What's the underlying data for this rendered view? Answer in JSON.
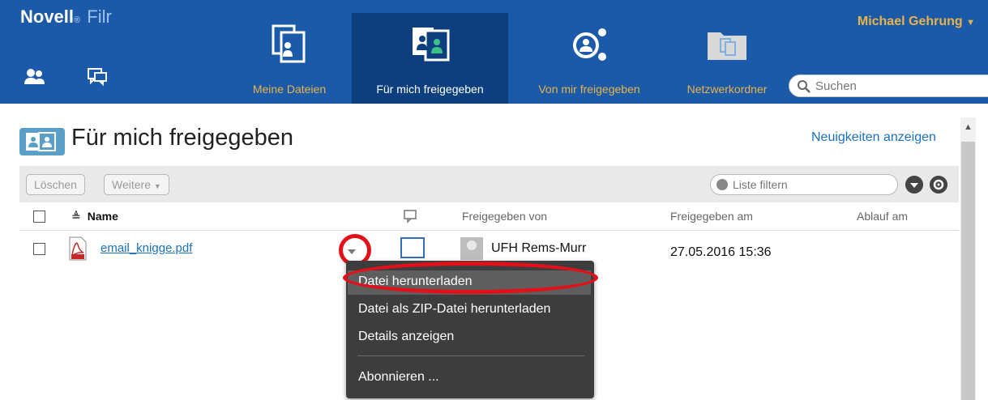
{
  "header": {
    "logo_brand": "Novell",
    "logo_product": "Filr",
    "user_name": "Michael Gehrung",
    "search_placeholder": "Suchen",
    "nav_tabs": [
      {
        "label": "Meine Dateien"
      },
      {
        "label": "Für mich freigegeben"
      },
      {
        "label": "Von mir freigegeben"
      },
      {
        "label": "Netzwerkordner"
      }
    ],
    "active_tab": "Für mich freigegeben",
    "colors": {
      "background": "#1a5aa8",
      "active_tab": "#0d3f7e",
      "accent": "#e8b44a"
    }
  },
  "page": {
    "title": "Für mich freigegeben",
    "news_link": "Neuigkeiten anzeigen"
  },
  "toolbar": {
    "delete_label": "Löschen",
    "more_label": "Weitere",
    "filter_placeholder": "Liste filtern"
  },
  "table": {
    "columns": [
      "Name",
      "Freigegeben von",
      "Freigegeben am",
      "Ablauf am"
    ],
    "sort_indicator": "≜",
    "rows": [
      {
        "name": "email_knigge.pdf",
        "shared_by": "UFH Rems-Murr",
        "shared_on": "27.05.2016 15:36",
        "expires": ""
      }
    ]
  },
  "context_menu": {
    "items": [
      {
        "label": "Datei herunterladen",
        "highlighted": true
      },
      {
        "label": "Datei als ZIP-Datei herunterladen"
      },
      {
        "label": "Details anzeigen"
      },
      {
        "label": "Abonnieren ..."
      }
    ]
  },
  "annotations": {
    "color": "#e3101a"
  },
  "icons": [
    "users-icon",
    "comments-icon",
    "my-files-icon",
    "shared-with-me-icon",
    "shared-by-me-icon",
    "network-folders-icon",
    "search-icon",
    "pdf-file-icon",
    "filter-icon",
    "gear-icon"
  ]
}
